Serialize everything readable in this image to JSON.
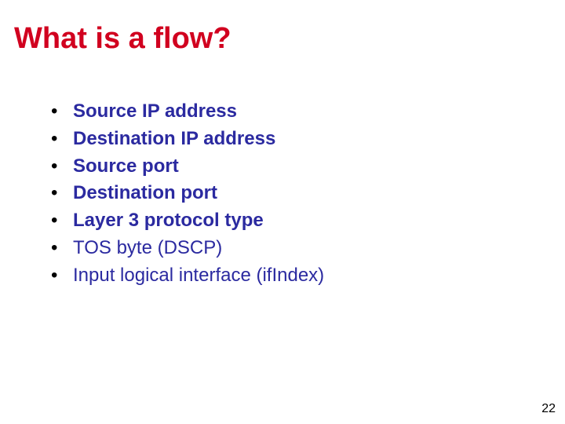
{
  "title": "What is a flow?",
  "bullets": [
    {
      "text": "Source IP address",
      "bold": true
    },
    {
      "text": "Destination IP address",
      "bold": true
    },
    {
      "text": "Source port",
      "bold": true
    },
    {
      "text": "Destination port",
      "bold": true
    },
    {
      "text": "Layer 3 protocol type",
      "bold": true
    },
    {
      "text": "TOS byte (DSCP)",
      "bold": false
    },
    {
      "text": "Input logical interface (ifIndex)",
      "bold": false
    }
  ],
  "page_number": "22"
}
